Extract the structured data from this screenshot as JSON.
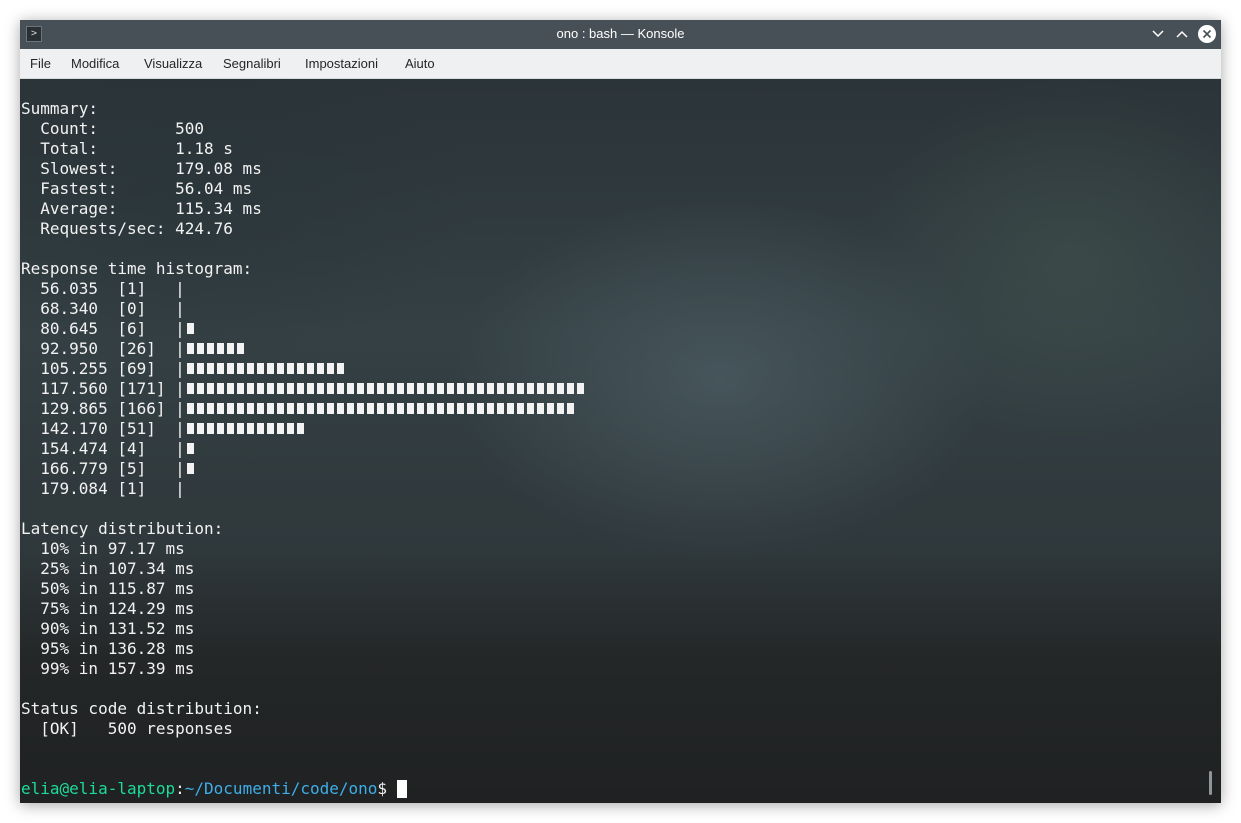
{
  "window": {
    "title": "ono : bash — Konsole",
    "icons": {
      "app": "terminal-app-icon",
      "minimize": "chevron-down-icon",
      "maximize": "chevron-up-icon",
      "close": "close-icon"
    }
  },
  "menubar": {
    "items": [
      "File",
      "Modifica",
      "Visualizza",
      "Segnalibri",
      "Impostazioni",
      "Aiuto"
    ]
  },
  "terminal": {
    "summary": {
      "heading": "Summary:",
      "rows": [
        {
          "label": "Count:",
          "value": "500"
        },
        {
          "label": "Total:",
          "value": "1.18 s"
        },
        {
          "label": "Slowest:",
          "value": "179.08 ms"
        },
        {
          "label": "Fastest:",
          "value": "56.04 ms"
        },
        {
          "label": "Average:",
          "value": "115.34 ms"
        },
        {
          "label": "Requests/sec:",
          "value": "424.76"
        }
      ]
    },
    "histogram": {
      "heading": "Response time histogram:",
      "rows": [
        {
          "bucket": "56.035",
          "count": "[1]",
          "blocks": 0
        },
        {
          "bucket": "68.340",
          "count": "[0]",
          "blocks": 0
        },
        {
          "bucket": "80.645",
          "count": "[6]",
          "blocks": 1
        },
        {
          "bucket": "92.950",
          "count": "[26]",
          "blocks": 6
        },
        {
          "bucket": "105.255",
          "count": "[69]",
          "blocks": 16
        },
        {
          "bucket": "117.560",
          "count": "[171]",
          "blocks": 40
        },
        {
          "bucket": "129.865",
          "count": "[166]",
          "blocks": 39
        },
        {
          "bucket": "142.170",
          "count": "[51]",
          "blocks": 12
        },
        {
          "bucket": "154.474",
          "count": "[4]",
          "blocks": 1
        },
        {
          "bucket": "166.779",
          "count": "[5]",
          "blocks": 1
        },
        {
          "bucket": "179.084",
          "count": "[1]",
          "blocks": 0
        }
      ]
    },
    "latency": {
      "heading": "Latency distribution:",
      "rows": [
        "10% in 97.17 ms",
        "25% in 107.34 ms",
        "50% in 115.87 ms",
        "75% in 124.29 ms",
        "90% in 131.52 ms",
        "95% in 136.28 ms",
        "99% in 157.39 ms"
      ]
    },
    "status": {
      "heading": "Status code distribution:",
      "rows": [
        {
          "code": "[OK]",
          "text": "500 responses"
        }
      ]
    },
    "prompt": {
      "user_host": "elia@elia-laptop",
      "colon": ":",
      "path": "~/Documenti/code/ono",
      "symbol": "$"
    }
  },
  "colors": {
    "titlebar": "#475057",
    "menubar": "#eff0f1",
    "prompt_user": "#1cdc9a",
    "prompt_path": "#3daee9",
    "text": "#f2f2f2"
  }
}
